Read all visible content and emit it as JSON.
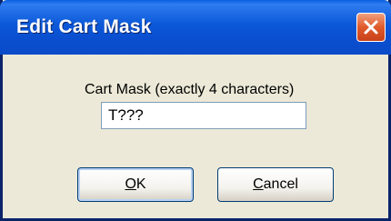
{
  "window": {
    "title": "Edit Cart Mask"
  },
  "dialog": {
    "mask_label": "Cart Mask (exactly 4 characters)",
    "mask_value": "T???",
    "ok": {
      "mnemonic": "O",
      "rest": "K"
    },
    "cancel": {
      "mnemonic": "C",
      "rest": "ancel"
    }
  },
  "icons": {
    "close": "close-icon"
  },
  "colors": {
    "titlebar": "#0B58D8",
    "close_button": "#E05A2A",
    "dialog_bg": "#ECE9D8"
  }
}
